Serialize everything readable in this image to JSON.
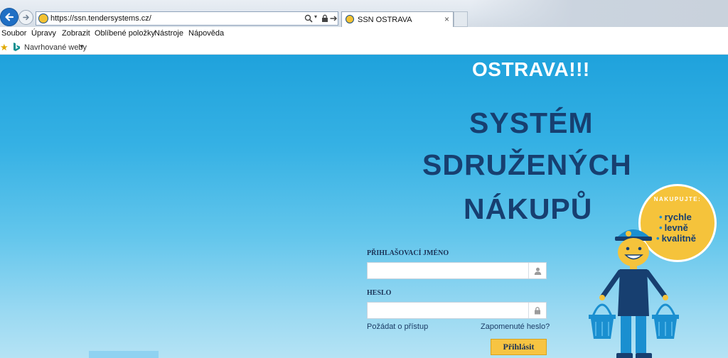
{
  "browser": {
    "url": "https://ssn.tendersystems.cz/",
    "tab_title": "SSN OSTRAVA",
    "tab_close": "×",
    "menu": [
      "Soubor",
      "Úpravy",
      "Zobrazit",
      "Oblíbené položky",
      "Nástroje",
      "Nápověda"
    ],
    "favorites_label": "Navrhované weby",
    "favorites_caret": "▼"
  },
  "page": {
    "headline_top": "OSTRAVA!!!",
    "headline_lines": [
      "SYSTÉM",
      "SDRUŽENÝCH",
      "NÁKUPŮ"
    ],
    "login": {
      "username_label": "PŘIHLAŠOVACÍ JMÉNO",
      "username_value": "",
      "password_label": "HESLO",
      "password_value": "",
      "request_access": "Požádat o přístup",
      "forgot_password": "Zapomenuté heslo?",
      "submit_label": "Přihlásit"
    },
    "badge": {
      "title": "NAKUPUJTE:",
      "bullet": "•",
      "items": [
        "rychle",
        "levně",
        "kvalitně"
      ]
    }
  },
  "colors": {
    "brand_dark": "#173f70",
    "brand_yellow": "#f5c33b",
    "sky": "#35b1e4"
  }
}
